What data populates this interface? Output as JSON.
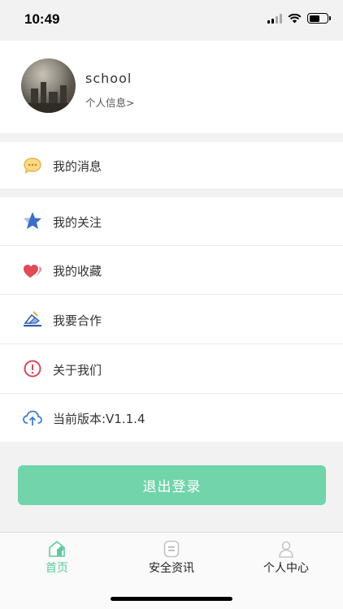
{
  "status_bar": {
    "time": "10:49"
  },
  "profile": {
    "username": "school",
    "link": "个人信息>"
  },
  "menu": {
    "messages": "我的消息",
    "follows": "我的关注",
    "favorites": "我的收藏",
    "cooperate": "我要合作",
    "about": "关于我们",
    "version": "当前版本:V1.1.4"
  },
  "logout_label": "退出登录",
  "tabs": [
    {
      "label": "首页",
      "icon": "home-icon",
      "active": true
    },
    {
      "label": "安全资讯",
      "icon": "news-icon",
      "active": false
    },
    {
      "label": "个人中心",
      "icon": "person-icon",
      "active": false
    }
  ],
  "colors": {
    "accent": "#71d4ab",
    "tab_active": "#5fc9a0"
  }
}
